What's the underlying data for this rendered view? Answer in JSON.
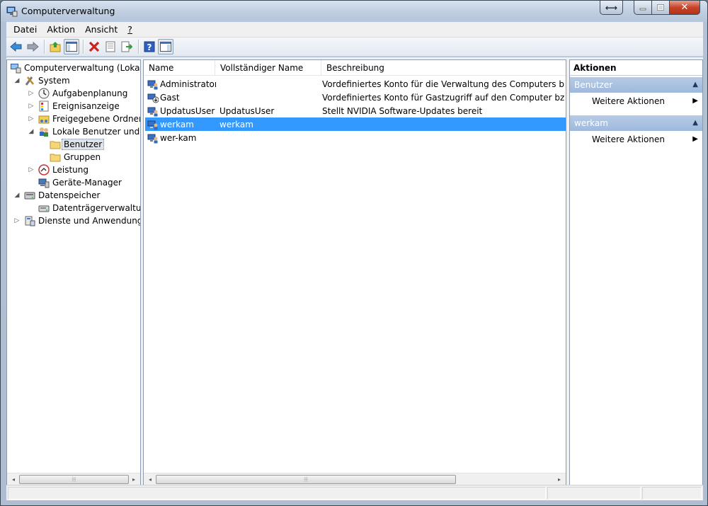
{
  "window": {
    "title": "Computerverwaltung",
    "buttons": {
      "resize": "⟷",
      "minimize": "–",
      "maximize": "□",
      "close": "✕"
    }
  },
  "menu": [
    {
      "label": "Datei"
    },
    {
      "label": "Aktion"
    },
    {
      "label": "Ansicht"
    },
    {
      "label": "?"
    }
  ],
  "toolbar": {
    "buttons": [
      "back-icon",
      "forward-icon",
      "up-folder-icon",
      "show-hide-tree-icon",
      "delete-icon",
      "properties-icon",
      "export-list-icon",
      "help-icon",
      "show-hide-action-pane-icon"
    ]
  },
  "tree": {
    "items": [
      {
        "label": "Computerverwaltung (Lokal)",
        "level": 0,
        "expander": ""
      },
      {
        "label": "System",
        "level": 1,
        "expander": "◢"
      },
      {
        "label": "Aufgabenplanung",
        "level": 2,
        "expander": "▷"
      },
      {
        "label": "Ereignisanzeige",
        "level": 2,
        "expander": "▷"
      },
      {
        "label": "Freigegebene Ordner",
        "level": 2,
        "expander": "▷"
      },
      {
        "label": "Lokale Benutzer und Gruppen",
        "level": 2,
        "expander": "◢"
      },
      {
        "label": "Benutzer",
        "level": 3,
        "expander": "",
        "selected": true
      },
      {
        "label": "Gruppen",
        "level": 3,
        "expander": ""
      },
      {
        "label": "Leistung",
        "level": 2,
        "expander": "▷"
      },
      {
        "label": "Geräte-Manager",
        "level": 2,
        "expander": ""
      },
      {
        "label": "Datenspeicher",
        "level": 1,
        "expander": "◢"
      },
      {
        "label": "Datenträgerverwaltung",
        "level": 2,
        "expander": ""
      },
      {
        "label": "Dienste und Anwendungen",
        "level": 1,
        "expander": "▷"
      }
    ]
  },
  "list": {
    "columns": [
      "Name",
      "Vollständiger Name",
      "Beschreibung"
    ],
    "rows": [
      {
        "name": "Administrator",
        "fullname": "",
        "description": "Vordefiniertes Konto für die Verwaltung des Computers bzw. der Domäne"
      },
      {
        "name": "Gast",
        "fullname": "",
        "description": "Vordefiniertes Konto für Gastzugriff auf den Computer bzw. die Domäne"
      },
      {
        "name": "UpdatusUser",
        "fullname": "UpdatusUser",
        "description": "Stellt NVIDIA Software-Updates bereit"
      },
      {
        "name": "werkam",
        "fullname": "werkam",
        "description": "",
        "selected": true
      },
      {
        "name": "wer-kam",
        "fullname": "",
        "description": ""
      }
    ]
  },
  "actions": {
    "title": "Aktionen",
    "sections": [
      {
        "header": "Benutzer",
        "item": "Weitere Aktionen"
      },
      {
        "header": "werkam",
        "item": "Weitere Aktionen"
      }
    ]
  },
  "scroll": {
    "left": "◂",
    "right": "▸",
    "grip": "⦙⦙⦙"
  },
  "colors": {
    "selection": "#3399ff",
    "section_header": "#a9c1df"
  }
}
